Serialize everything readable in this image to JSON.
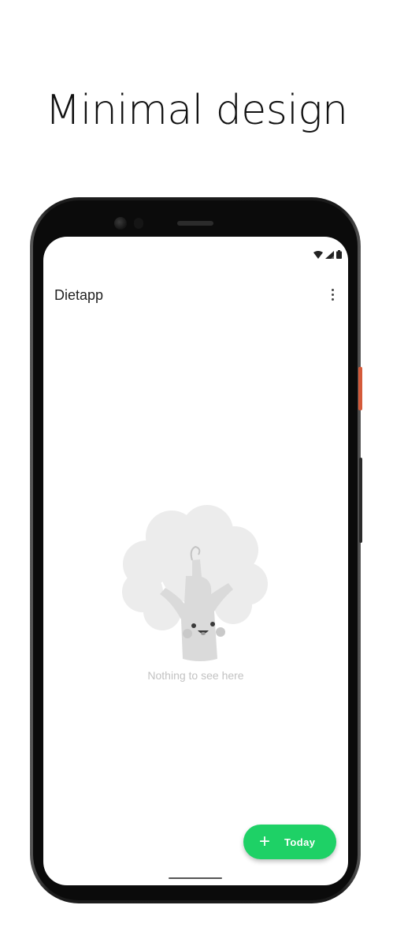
{
  "promo": {
    "headline": "Minimal design"
  },
  "status_bar": {
    "icons": [
      "wifi-icon",
      "signal-icon",
      "battery-icon"
    ]
  },
  "app_bar": {
    "title": "Dietapp",
    "menu_icon": "more-vert-icon"
  },
  "empty_state": {
    "illustration": "broccoli-illustration",
    "message": "Nothing to see here"
  },
  "fab": {
    "icon": "plus-icon",
    "icon_glyph": "+",
    "label": "Today",
    "color": "#1ed166"
  },
  "colors": {
    "accent": "#1ed166",
    "illustration_gray": "#ececec",
    "device_orange": "#d45a3a"
  }
}
